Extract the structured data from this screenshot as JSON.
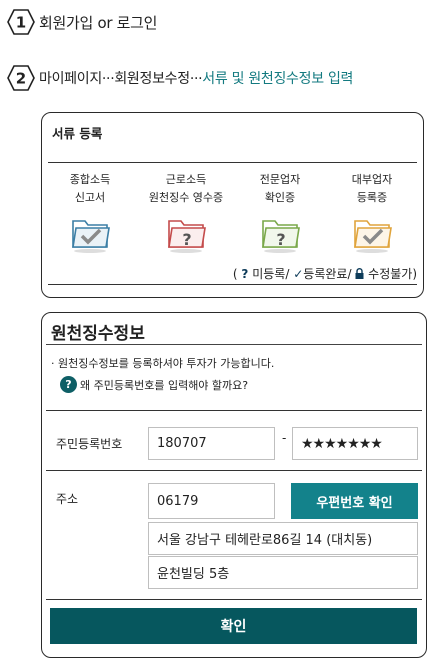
{
  "steps": [
    {
      "num": "1",
      "text": "회원가입 or 로그인"
    },
    {
      "num": "2",
      "path": "마이페이지···회원정보수정···",
      "current": "서류 및 원천징수정보 입력"
    }
  ],
  "documents": {
    "title": "서류 등록",
    "items": [
      {
        "line1": "종합소득",
        "line2": "신고서",
        "status": "registered",
        "color": "#3b7ea5",
        "icon": "check-folder-icon"
      },
      {
        "line1": "근로소득",
        "line2": "원천징수 영수증",
        "status": "unregistered",
        "color": "#c44b4b",
        "icon": "question-folder-icon"
      },
      {
        "line1": "전문업자",
        "line2": "확인증",
        "status": "unregistered",
        "color": "#7aa84a",
        "icon": "question-folder-icon"
      },
      {
        "line1": "대부업자",
        "line2": "등록증",
        "status": "registered",
        "color": "#e0a43c",
        "icon": "check-folder-icon"
      }
    ],
    "legend": {
      "open": "(",
      "unregistered": "미등록/",
      "registered": "등록완료/",
      "locked": "수정불가)"
    }
  },
  "tax_info": {
    "title": "원천징수정보",
    "notice": "· 원천징수정보를 등록하셔야 투자가 가능합니다.",
    "help_icon": "?",
    "help": "왜 주민등록번호를 입력해야 할까요?",
    "rrn_label": "주민등록번호",
    "rrn_front": "180707",
    "rrn_separator": "-",
    "rrn_back": "★★★★★★★",
    "address_label": "주소",
    "zipcode": "06179",
    "zip_button": "우편번호 확인",
    "address1": "서울 강남구 테헤란로86길 14 (대치동)",
    "address2": "윤천빌딩 5층",
    "confirm": "확인"
  }
}
